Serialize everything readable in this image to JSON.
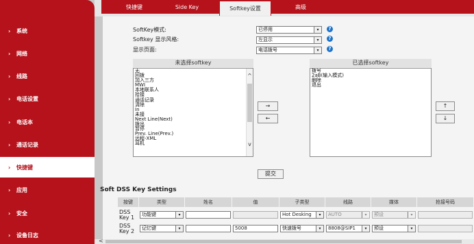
{
  "sidebar": {
    "items": [
      {
        "label": "系统"
      },
      {
        "label": "网络"
      },
      {
        "label": "线路"
      },
      {
        "label": "电话设置"
      },
      {
        "label": "电话本"
      },
      {
        "label": "通话记录"
      },
      {
        "label": "快捷键",
        "active": true
      },
      {
        "label": "应用"
      },
      {
        "label": "安全"
      },
      {
        "label": "设备日志"
      }
    ]
  },
  "tabs": [
    {
      "label": "快捷键"
    },
    {
      "label": "Side Key"
    },
    {
      "label": "Softkey设置",
      "active": true
    },
    {
      "label": "高级"
    }
  ],
  "settings": {
    "mode_label": "SoftKey模式:",
    "mode_value": "已停用",
    "style_label": "Softkey 显示风格:",
    "style_value": "左显示",
    "page_label": "显示页面:",
    "page_value": "电话拨号"
  },
  "unselected": {
    "title": "未选择softkey",
    "items": [
      "无",
      "回拨",
      "加入三方",
      "MWI",
      "本地联系人",
      "拾接",
      "通话记录",
      "清除",
      "In",
      "未接",
      "Next Line(Next)",
      "拨出",
      "暂停",
      "Prev. Line(Prev.)",
      "远程-XML",
      "耳机"
    ]
  },
  "selected": {
    "title": "已选择softkey",
    "items": [
      "拨号",
      "2aB(输入模式)",
      "删除",
      "退出"
    ]
  },
  "buttons": {
    "move_right": "→",
    "move_left": "←",
    "move_up": "↑",
    "move_down": "↓",
    "submit": "提交"
  },
  "dss": {
    "title": "Soft DSS Key Settings",
    "headers": [
      "按键",
      "类型",
      "姓名",
      "值",
      "子类型",
      "线路",
      "媒体",
      "抢接号码"
    ],
    "rows": [
      {
        "key": "DSS Key 1",
        "type": "功能键",
        "name": "",
        "value": "",
        "subtype": "Hot Desking",
        "line": "AUTO",
        "media": "预设",
        "pickup": ""
      },
      {
        "key": "DSS Key 2",
        "type": "记忆键",
        "name": "",
        "value": "5008",
        "subtype": "快速拨号",
        "line": "8808@SIP1",
        "media": "预设",
        "pickup": ""
      }
    ]
  },
  "icons": {
    "help": "?",
    "chevron_right": "›",
    "scroll_up": "^",
    "scroll_down": "v",
    "select_arrow": "▾",
    "hscroll_left": "<"
  }
}
